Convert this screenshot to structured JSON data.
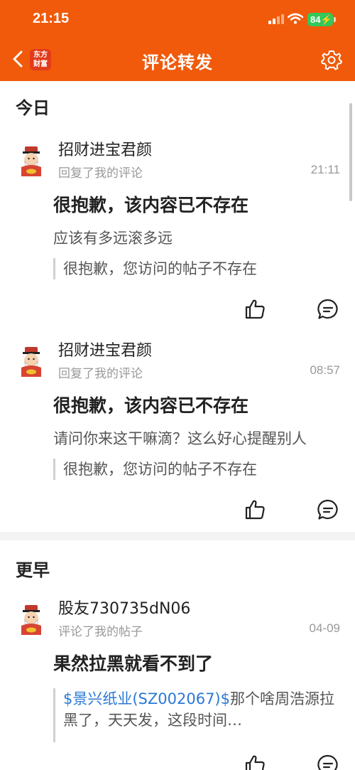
{
  "status_bar": {
    "time": "21:15",
    "battery": "84"
  },
  "nav": {
    "title": "评论转发",
    "logo_line1": "东方",
    "logo_line2": "财富"
  },
  "sections": {
    "today": "今日",
    "earlier": "更早"
  },
  "items": [
    {
      "username": "招财进宝君颜",
      "action": "回复了我的评论",
      "time": "21:11",
      "headline": "很抱歉，该内容已不存在",
      "reply": "应该有多远滚多远",
      "quote": "很抱歉，您访问的帖子不存在"
    },
    {
      "username": "招财进宝君颜",
      "action": "回复了我的评论",
      "time": "08:57",
      "headline": "很抱歉，该内容已不存在",
      "reply": "请问你来这干嘛滴？这么好心提醒别人",
      "quote": "很抱歉，您访问的帖子不存在"
    },
    {
      "username": "股友730735dN06",
      "action": "评论了我的帖子",
      "time": "04-09",
      "headline": "果然拉黑就看不到了",
      "quote_link": "$景兴纸业(SZ002067)$",
      "quote_text": "那个啥周浩源拉黑了，天天发，这段时间…"
    }
  ],
  "icons": {
    "back": "chevron-left-icon",
    "settings": "gear-icon",
    "like": "thumbs-up-icon",
    "comment": "comment-bubble-icon"
  },
  "colors": {
    "brand": "#f05a0a",
    "link": "#2a78d6",
    "battery": "#34c759"
  }
}
